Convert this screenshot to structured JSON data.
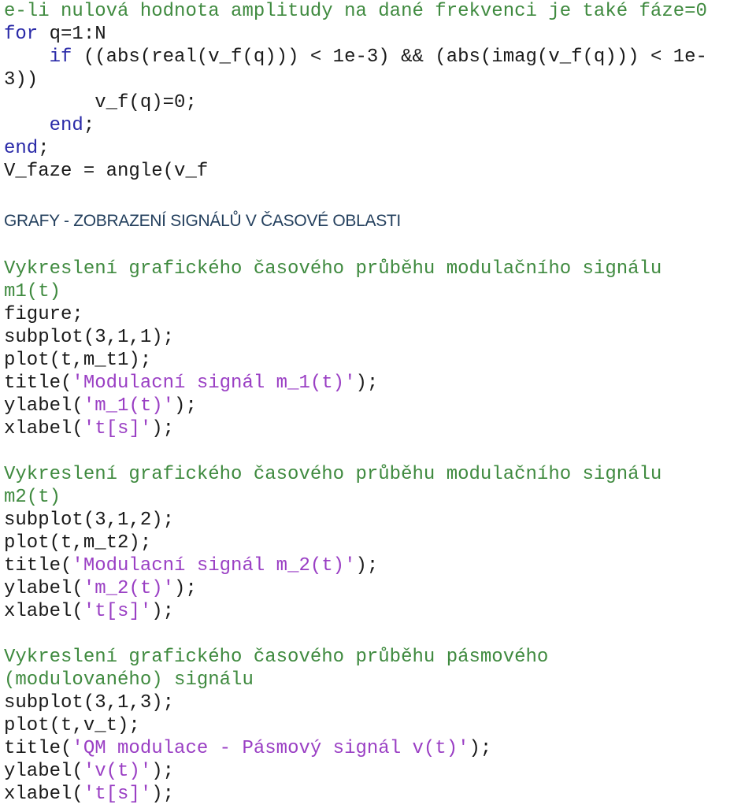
{
  "document": {
    "block1": {
      "comment_tail": "e-li nulová hodnota amplitudy na dané frekvenci je také fáze=0",
      "for_kw": "for",
      "for_rest": " q=1:N",
      "if_indent": "    ",
      "if_kw": "if",
      "if_rest": " ((abs(real(v_f(q))) < 1e-3) && (abs(imag(v_f(q))) < 1e-",
      "if_wrap": "3))",
      "assign": "        v_f(q)=0;",
      "end_inner_indent": "    ",
      "end_kw": "end",
      "semicolon": ";",
      "faze": "V_faze = angle(v_f"
    },
    "section_heading": "GRAFY - ZOBRAZENÍ SIGNÁLŮ V ČASOVÉ OBLASTI",
    "blocks": [
      {
        "comment_line1": "Vykreslení grafického časového průběhu modulačního signálu",
        "comment_line2": "m1(t)",
        "figure": "figure;",
        "subplot": "subplot(3,1,1);",
        "plot": "plot(t,m_t1);",
        "title_fn": "title(",
        "title_str": "'Modulacní signál m_1(t)'",
        "ylabel_fn": "ylabel(",
        "ylabel_str": "'m_1(t)'",
        "xlabel_fn": "xlabel(",
        "xlabel_str": "'t[s]'",
        "close": ");"
      },
      {
        "comment_line1": "Vykreslení grafického časového průběhu modulačního signálu",
        "comment_line2": "m2(t)",
        "subplot": "subplot(3,1,2);",
        "plot": "plot(t,m_t2);",
        "title_fn": "title(",
        "title_str": "'Modulacní signál m_2(t)'",
        "ylabel_fn": "ylabel(",
        "ylabel_str": "'m_2(t)'",
        "xlabel_fn": "xlabel(",
        "xlabel_str": "'t[s]'",
        "close": ");"
      },
      {
        "comment_line1": "Vykreslení grafického časového průběhu pásmového",
        "comment_line2": "(modulovaného) signálu",
        "subplot": "subplot(3,1,3);",
        "plot": "plot(t,v_t);",
        "title_fn": "title(",
        "title_str": "'QM modulace - Pásmový signál v(t)'",
        "ylabel_fn": "ylabel(",
        "ylabel_str": "'v(t)'",
        "xlabel_fn": "xlabel(",
        "xlabel_str": "'t[s]'",
        "close": ");"
      }
    ]
  },
  "colors": {
    "comment": "#3f8a3f",
    "keyword": "#2a2aa8",
    "string": "#9a3fc4",
    "code": "#1a1a1a",
    "heading": "#24405e"
  }
}
